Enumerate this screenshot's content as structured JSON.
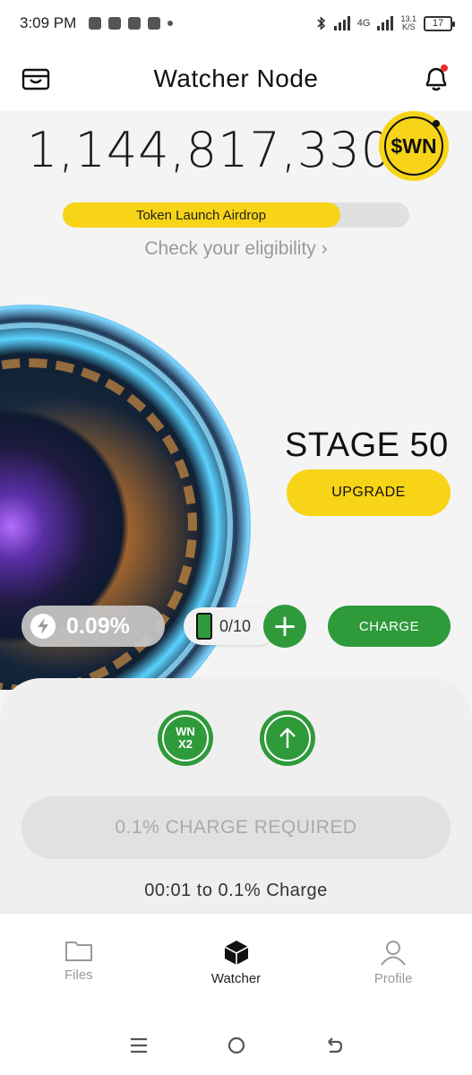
{
  "status_bar": {
    "time": "3:09 PM",
    "network_type": "4G",
    "speed": "13.1",
    "speed_unit": "K/S",
    "battery": "17"
  },
  "header": {
    "title": "Watcher Node",
    "wallet_icon": "wallet-icon",
    "bell_icon": "bell-icon"
  },
  "balance": {
    "amount": "1,144,817,330",
    "token": "$WN"
  },
  "airdrop": {
    "label": "Token Launch Airdrop",
    "progress": 0.8,
    "eligibility_link": "Check your eligibility ›"
  },
  "node": {
    "stage": "STAGE 50",
    "upgrade_label": "UPGRADE"
  },
  "charge": {
    "percent": "0.09%",
    "batteries": "0/10",
    "plus_label": "+",
    "charge_label": "CHARGE"
  },
  "actions": {
    "boost_line1": "WN",
    "boost_line2": "X2",
    "required_label": "0.1% CHARGE REQUIRED",
    "timer": "00:01  to 0.1% Charge"
  },
  "bottom_nav": [
    {
      "label": "Files",
      "icon": "folder-icon",
      "active": false
    },
    {
      "label": "Watcher",
      "icon": "cube-icon",
      "active": true
    },
    {
      "label": "Profile",
      "icon": "person-icon",
      "active": false
    }
  ],
  "colors": {
    "accent_yellow": "#f7d417",
    "accent_green": "#2f9a3a",
    "background": "#f4f4f4"
  }
}
